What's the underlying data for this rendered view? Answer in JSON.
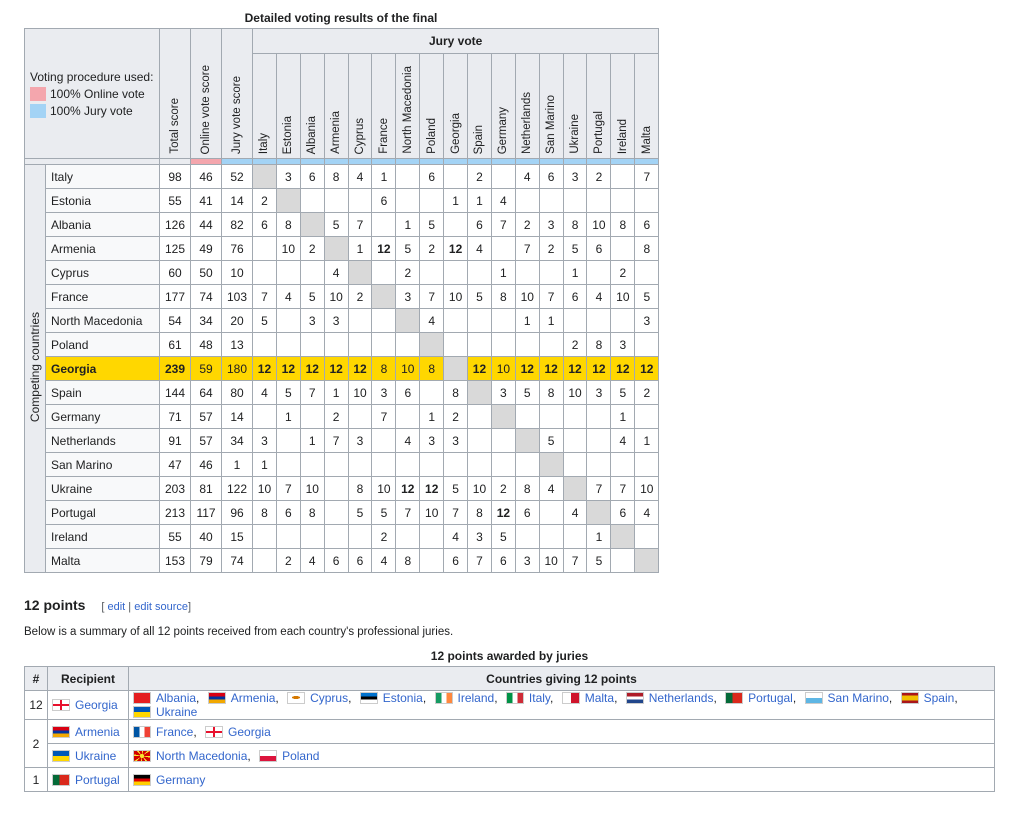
{
  "results": {
    "caption": "Detailed voting results of the final",
    "legend_title": "Voting procedure used:",
    "legend": [
      {
        "label": "100% Online vote",
        "color": "#f4a6ad"
      },
      {
        "label": "100% Jury vote",
        "color": "#a3d3f5"
      }
    ],
    "col_total": "Total score",
    "col_online": "Online vote score",
    "col_jury": "Jury vote score",
    "jury_vote": "Jury vote",
    "competing_countries": "Competing countries",
    "voters": [
      "Italy",
      "Estonia",
      "Albania",
      "Armenia",
      "Cyprus",
      "France",
      "North Macedonia",
      "Poland",
      "Georgia",
      "Spain",
      "Germany",
      "Netherlands",
      "San Marino",
      "Ukraine",
      "Portugal",
      "Ireland",
      "Malta"
    ],
    "rows": [
      {
        "country": "Italy",
        "total": "98",
        "online": "46",
        "jury": "52",
        "votes": [
          "",
          "3",
          "6",
          "8",
          "4",
          "1",
          "",
          "6",
          "",
          "2",
          "",
          "4",
          "6",
          "3",
          "2",
          "",
          "7"
        ]
      },
      {
        "country": "Estonia",
        "total": "55",
        "online": "41",
        "jury": "14",
        "votes": [
          "2",
          "",
          "",
          "",
          "",
          "6",
          "",
          "",
          "1",
          "1",
          "4",
          "",
          "",
          "",
          "",
          "",
          ""
        ]
      },
      {
        "country": "Albania",
        "total": "126",
        "online": "44",
        "jury": "82",
        "votes": [
          "6",
          "8",
          "",
          "5",
          "7",
          "",
          "1",
          "5",
          "",
          "6",
          "7",
          "2",
          "3",
          "8",
          "10",
          "8",
          "6"
        ]
      },
      {
        "country": "Armenia",
        "total": "125",
        "online": "49",
        "jury": "76",
        "votes": [
          "",
          "10",
          "2",
          "",
          "1",
          "12",
          "5",
          "2",
          "12",
          "4",
          "",
          "7",
          "2",
          "5",
          "6",
          "",
          "8"
        ]
      },
      {
        "country": "Cyprus",
        "total": "60",
        "online": "50",
        "jury": "10",
        "votes": [
          "",
          "",
          "",
          "4",
          "",
          "",
          "2",
          "",
          "",
          "",
          "1",
          "",
          "",
          "1",
          "",
          "2",
          ""
        ]
      },
      {
        "country": "France",
        "total": "177",
        "online": "74",
        "jury": "103",
        "votes": [
          "7",
          "4",
          "5",
          "10",
          "2",
          "",
          "3",
          "7",
          "10",
          "5",
          "8",
          "10",
          "7",
          "6",
          "4",
          "10",
          "5"
        ]
      },
      {
        "country": "North Macedonia",
        "total": "54",
        "online": "34",
        "jury": "20",
        "votes": [
          "5",
          "",
          "3",
          "3",
          "",
          "",
          "",
          "4",
          "",
          "",
          "",
          "1",
          "1",
          "",
          "",
          "",
          "3"
        ]
      },
      {
        "country": "Poland",
        "total": "61",
        "online": "48",
        "jury": "13",
        "votes": [
          "",
          "",
          "",
          "",
          "",
          "",
          "",
          "",
          "",
          "",
          "",
          "",
          "",
          "2",
          "8",
          "3",
          ""
        ]
      },
      {
        "country": "Georgia",
        "total": "239",
        "online": "59",
        "jury": "180",
        "votes": [
          "12",
          "12",
          "12",
          "12",
          "12",
          "8",
          "10",
          "8",
          "",
          "12",
          "10",
          "12",
          "12",
          "12",
          "12",
          "12",
          "12"
        ]
      },
      {
        "country": "Spain",
        "total": "144",
        "online": "64",
        "jury": "80",
        "votes": [
          "4",
          "5",
          "7",
          "1",
          "10",
          "3",
          "6",
          "",
          "8",
          "",
          "3",
          "5",
          "8",
          "10",
          "3",
          "5",
          "2"
        ]
      },
      {
        "country": "Germany",
        "total": "71",
        "online": "57",
        "jury": "14",
        "votes": [
          "",
          "1",
          "",
          "2",
          "",
          "7",
          "",
          "1",
          "2",
          "",
          "",
          "",
          "",
          "",
          "",
          "1",
          ""
        ]
      },
      {
        "country": "Netherlands",
        "total": "91",
        "online": "57",
        "jury": "34",
        "votes": [
          "3",
          "",
          "1",
          "7",
          "3",
          "",
          "4",
          "3",
          "3",
          "",
          "",
          "",
          "5",
          "",
          "",
          "4",
          "1"
        ]
      },
      {
        "country": "San Marino",
        "total": "47",
        "online": "46",
        "jury": "1",
        "votes": [
          "1",
          "",
          "",
          "",
          "",
          "",
          "",
          "",
          "",
          "",
          "",
          "",
          "",
          "",
          "",
          "",
          ""
        ]
      },
      {
        "country": "Ukraine",
        "total": "203",
        "online": "81",
        "jury": "122",
        "votes": [
          "10",
          "7",
          "10",
          "",
          "8",
          "10",
          "12",
          "12",
          "5",
          "10",
          "2",
          "8",
          "4",
          "",
          "7",
          "7",
          "10"
        ]
      },
      {
        "country": "Portugal",
        "total": "213",
        "online": "117",
        "jury": "96",
        "votes": [
          "8",
          "6",
          "8",
          "",
          "5",
          "5",
          "7",
          "10",
          "7",
          "8",
          "12",
          "6",
          "",
          "4",
          "",
          "6",
          "4"
        ]
      },
      {
        "country": "Ireland",
        "total": "55",
        "online": "40",
        "jury": "15",
        "votes": [
          "",
          "",
          "",
          "",
          "",
          "2",
          "",
          "",
          "4",
          "3",
          "5",
          "",
          "",
          "",
          "1",
          "",
          ""
        ]
      },
      {
        "country": "Malta",
        "total": "153",
        "online": "79",
        "jury": "74",
        "votes": [
          "",
          "2",
          "4",
          "6",
          "6",
          "4",
          "8",
          "",
          "6",
          "7",
          "6",
          "3",
          "10",
          "7",
          "5",
          "",
          ""
        ]
      }
    ],
    "winner": "Georgia",
    "winner_color": "#ffd700"
  },
  "section": {
    "heading": "12 points",
    "edit_open": "[",
    "edit": "edit",
    "divider": "|",
    "edit_source": "edit source",
    "edit_close": "]",
    "summary": "Below is a summary of all 12 points received from each country's professional juries."
  },
  "twelve": {
    "caption": "12 points awarded by juries",
    "headers": [
      "#",
      "Recipient",
      "Countries giving 12 points"
    ],
    "rows": [
      {
        "count": "12",
        "recipient": "Georgia",
        "recipient_flag": "georgia",
        "givers": [
          {
            "name": "Albania",
            "flag": "albania"
          },
          {
            "name": "Armenia",
            "flag": "armenia"
          },
          {
            "name": "Cyprus",
            "flag": "cyprus"
          },
          {
            "name": "Estonia",
            "flag": "estonia"
          },
          {
            "name": "Ireland",
            "flag": "ireland"
          },
          {
            "name": "Italy",
            "flag": "italy"
          },
          {
            "name": "Malta",
            "flag": "malta"
          },
          {
            "name": "Netherlands",
            "flag": "netherlands"
          },
          {
            "name": "Portugal",
            "flag": "portugal"
          },
          {
            "name": "San Marino",
            "flag": "san-marino"
          },
          {
            "name": "Spain",
            "flag": "spain"
          },
          {
            "name": "Ukraine",
            "flag": "ukraine"
          }
        ]
      },
      {
        "count": "2",
        "recipient": "Armenia",
        "recipient_flag": "armenia",
        "givers": [
          {
            "name": "France",
            "flag": "france"
          },
          {
            "name": "Georgia",
            "flag": "georgia"
          }
        ]
      },
      {
        "count": "",
        "recipient": "Ukraine",
        "recipient_flag": "ukraine",
        "givers": [
          {
            "name": "North Macedonia",
            "flag": "north-macedonia"
          },
          {
            "name": "Poland",
            "flag": "poland"
          }
        ]
      },
      {
        "count": "1",
        "recipient": "Portugal",
        "recipient_flag": "portugal",
        "givers": [
          {
            "name": "Germany",
            "flag": "germany"
          }
        ]
      }
    ],
    "link_color": "#3366cc"
  }
}
